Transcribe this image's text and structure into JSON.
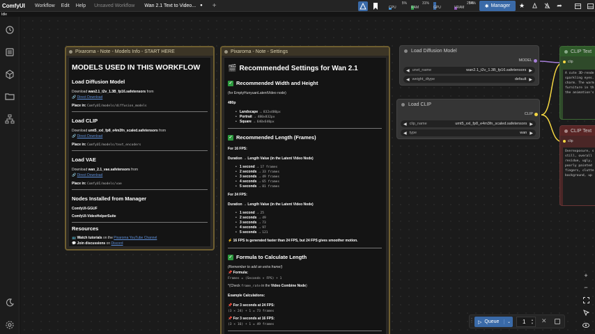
{
  "app": {
    "brand": "ComfyUI",
    "menu": [
      "Workflow",
      "Edit",
      "Help"
    ],
    "tabs": [
      {
        "label": "Unsaved Workflow",
        "active": false
      },
      {
        "label": "Wan 2.1 Text to Video...",
        "active": true
      }
    ],
    "tab_modified_dot": "●",
    "tab_add": "+",
    "status": "Idle",
    "meters": [
      {
        "label": "CPU",
        "value": "5%",
        "color": "#3a8fd8"
      },
      {
        "label": "RAM",
        "value": "31%",
        "color": "#2fa64a"
      },
      {
        "label": "GPU",
        "value": "",
        "color": "#3a6aa8"
      },
      {
        "label": "VRAM",
        "value": "25%",
        "color": "#8e4fb8"
      },
      {
        "label": "",
        "value": "14%",
        "color": "#888888"
      }
    ],
    "manager_label": "Manager",
    "accent": "#3a6aa8"
  },
  "models_note": {
    "title": "Pixaroma - Note - Models Info - START HERE",
    "heading": "MODELS USED IN THIS WORKFLOW",
    "sections": [
      {
        "title": "Load Diffusion Model",
        "download_prefix": "Download ",
        "file": "wan2.1_t2v_1.3B_fp16.safetensors",
        "download_suffix": " from",
        "link": "Direct Download",
        "place_prefix": "Place in: ",
        "path": "ComfyUI/models/diffusion_models"
      },
      {
        "title": "Load CLIP",
        "download_prefix": "Download ",
        "file": "umt5_xxl_fp8_e4m3fn_scaled.safetensors",
        "download_suffix": " from",
        "link": "Direct Download",
        "place_prefix": "Place in: ",
        "path": "ComfyUI/models/text_encoders"
      },
      {
        "title": "Load VAE",
        "download_prefix": "Download ",
        "file": "wan_2.1_vae.safetensors",
        "download_suffix": " from",
        "link": "Direct Download",
        "place_prefix": "Place in: ",
        "path": "ComfyUI/models/vae"
      }
    ],
    "nodes_title": "Nodes Installed from Manager",
    "nodes": [
      "ComfyUI-GGUF",
      "ComfyUI-VideoHelperSuite"
    ],
    "resources_title": "Resources",
    "resource_1_prefix": "Watch tutorials",
    "resource_1_mid": " on the ",
    "resource_1_link": "Pixaroma YouTube Channel",
    "resource_2_prefix": "Join discussions",
    "resource_2_mid": " on ",
    "resource_2_link": "Discord"
  },
  "settings_note": {
    "title": "Pixaroma - Note - Settings",
    "heading": "Recommended Settings for Wan 2.1",
    "wh_title": "Recommended Width and Height",
    "wh_sub": "(for EmptyHunyuanLatentVideo node)",
    "res_label": "480p",
    "sizes": [
      {
        "name": "Landscape",
        "value": "832x480px"
      },
      {
        "name": "Portrait",
        "value": "480x832px"
      },
      {
        "name": "Square",
        "value": "640x640px"
      }
    ],
    "len_title": "Recommended Length (Frames)",
    "fps16_title": "For 16 FPS:",
    "fps24_title": "For 24 FPS:",
    "duration_header": "Duration → Length Value (in the Latent Video Node)",
    "fps16": [
      {
        "sec": "1 second",
        "frames": "17 frames"
      },
      {
        "sec": "2 seconds",
        "frames": "33 frames"
      },
      {
        "sec": "3 seconds",
        "frames": "49 frames"
      },
      {
        "sec": "4 seconds",
        "frames": "65 frames"
      },
      {
        "sec": "5 seconds",
        "frames": "81 frames"
      }
    ],
    "fps24": [
      {
        "sec": "1 second",
        "frames": "25"
      },
      {
        "sec": "2 seconds",
        "frames": "49"
      },
      {
        "sec": "3 seconds",
        "frames": "73"
      },
      {
        "sec": "4 seconds",
        "frames": "97"
      },
      {
        "sec": "5 seconds",
        "frames": "121"
      }
    ],
    "fps_note_bold": "16 FPS is generated faster than 24 FPS, but 24 FPS gives smoother motion.",
    "formula_title": "Formula to Calculate Length",
    "formula_remember": "(Remember to add an extra frame!)",
    "formula_label": "Formula:",
    "formula": "Frames = (Seconds × FPS) + 1",
    "check_prefix": "*(Check ",
    "check_code": "frame_rate",
    "check_mid": " in the ",
    "check_node": "Video Combine Node",
    "check_suffix": ")",
    "examples_title": "Example Calculations:",
    "ex1_title": "For 3 seconds at 24 FPS:",
    "ex1": "(3 × 24) + 1 = 73 frames",
    "ex2_title": "For 3 seconds at 16 FPS:",
    "ex2": "(3 × 16) + 1 = 49 frames"
  },
  "load_diffusion": {
    "title": "Load Diffusion Model",
    "output": "MODEL",
    "widgets": [
      {
        "label": "unet_name",
        "value": "wan2.1_t2v_1.3B_fp16.safetensors"
      },
      {
        "label": "weight_dtype",
        "value": "default"
      }
    ]
  },
  "load_clip": {
    "title": "Load CLIP",
    "output": "CLIP",
    "widgets": [
      {
        "label": "clip_name",
        "value": "umt5_xxl_fp8_e4m3fn_scaled.safetensors"
      },
      {
        "label": "type",
        "value": "wan"
      }
    ]
  },
  "clip_pos": {
    "title": "CLIP Text",
    "input": "clip",
    "text": "A cute 3D-rende\nsparkling eyes.\ncharm. The warm\nfurniture in th\nthe animation's"
  },
  "clip_neg": {
    "title": "CLIP Text",
    "input": "clip",
    "text": "Overexposure, s\nstill, overall\nresidue, ugly,\npoorly painted\nfingers, clutte\nbackground, up"
  },
  "queue": {
    "label": "Queue",
    "count": "1"
  },
  "colors": {
    "note_border": "#6e5e30",
    "green_node": "#2f5a2a",
    "red_node": "#5a2626",
    "wire_yellow": "#f5d742"
  }
}
